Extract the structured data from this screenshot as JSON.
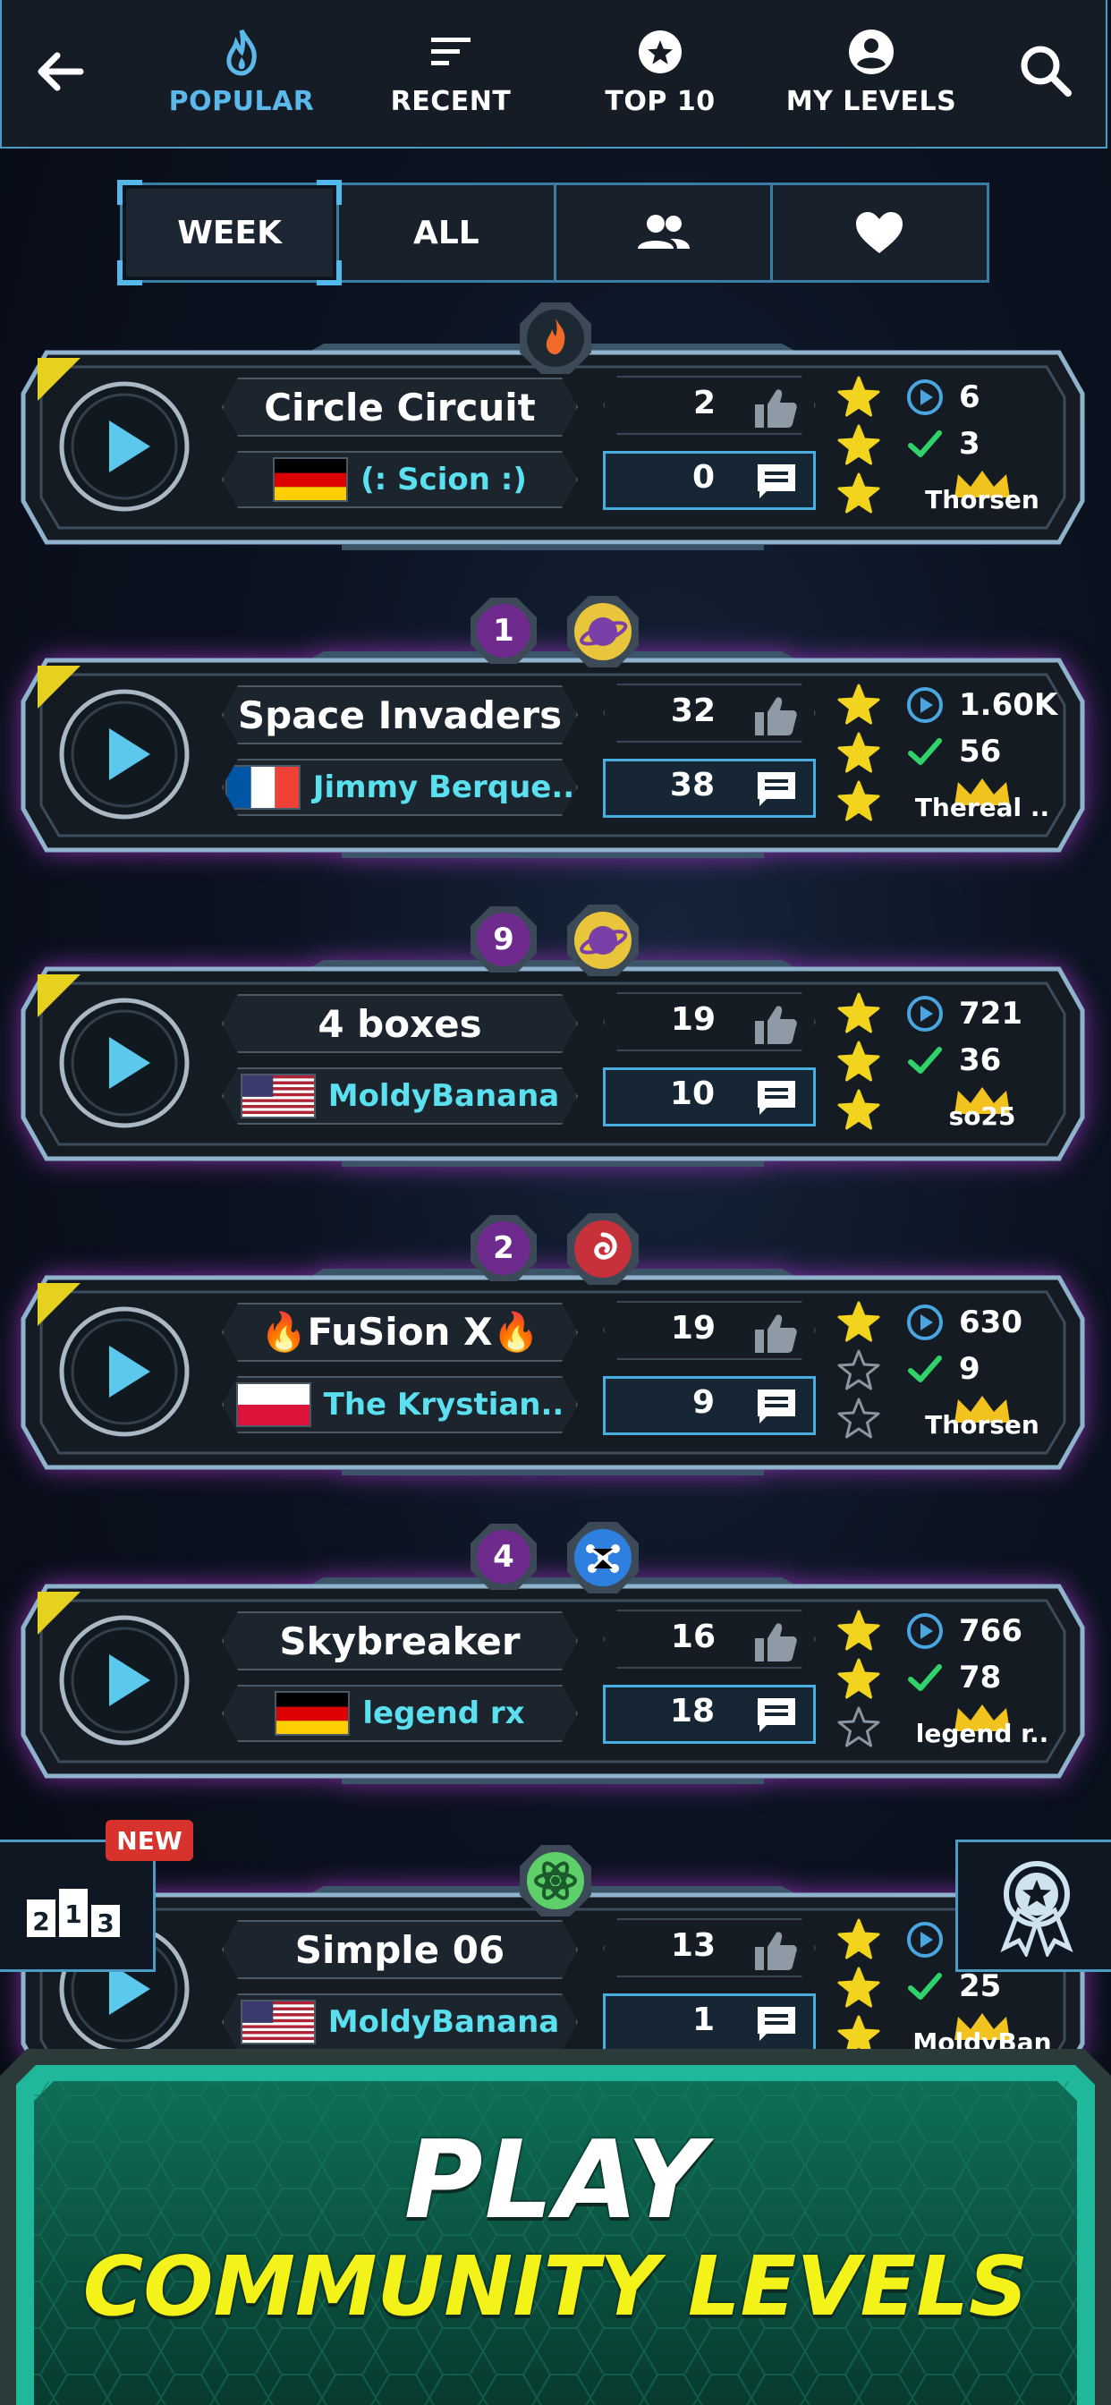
{
  "nav": {
    "tabs": [
      {
        "label": "POPULAR",
        "icon": "flame-icon",
        "active": true
      },
      {
        "label": "RECENT",
        "icon": "sort-lines-icon",
        "active": false
      },
      {
        "label": "TOP 10",
        "icon": "star-circle-icon",
        "active": false
      },
      {
        "label": "MY LEVELS",
        "icon": "account-circle-icon",
        "active": false
      }
    ]
  },
  "filters": {
    "week": "WEEK",
    "all": "ALL",
    "friends_icon": "people-icon",
    "favorites_icon": "heart-icon"
  },
  "levels": [
    {
      "name": "Circle Circuit",
      "author": "(: Scion :)",
      "flag": "germany",
      "likes": "2",
      "comments": "0",
      "stars": 3,
      "plays": "6",
      "completions": "3",
      "owner": "Thorsen",
      "owner_crown": false,
      "rank": "",
      "category_icon": "flame-icon"
    },
    {
      "name": "Space Invaders",
      "author": "Jimmy Berque..",
      "flag": "france",
      "likes": "32",
      "comments": "38",
      "stars": 3,
      "plays": "1.60K",
      "completions": "56",
      "owner": "Thereal ..",
      "owner_crown": true,
      "rank": "1",
      "category_icon": "planet-icon"
    },
    {
      "name": "4 boxes",
      "author": "MoldyBanana",
      "flag": "usa",
      "likes": "19",
      "comments": "10",
      "stars": 3,
      "plays": "721",
      "completions": "36",
      "owner": "so25",
      "owner_crown": true,
      "rank": "9",
      "category_icon": "planet-icon"
    },
    {
      "name": "🔥FuSion X🔥",
      "author": "The Krystian..",
      "flag": "poland",
      "likes": "19",
      "comments": "9",
      "stars": 1,
      "plays": "630",
      "completions": "9",
      "owner": "Thorsen",
      "owner_crown": true,
      "rank": "2",
      "category_icon": "spiral-icon"
    },
    {
      "name": "Skybreaker",
      "author": "legend rx",
      "flag": "germany",
      "likes": "16",
      "comments": "18",
      "stars": 2,
      "plays": "766",
      "completions": "78",
      "owner": "legend r..",
      "owner_crown": true,
      "rank": "4",
      "category_icon": "molecule-icon"
    },
    {
      "name": "Simple 06",
      "author": "MoldyBanana",
      "flag": "usa",
      "likes": "13",
      "comments": "1",
      "stars": 3,
      "plays": "",
      "completions": "25",
      "owner": "MoldyBan",
      "owner_crown": true,
      "rank": "",
      "category_icon": "atom-icon"
    }
  ],
  "side": {
    "new_badge": "NEW",
    "podium_digits": [
      "2",
      "1",
      "3"
    ]
  },
  "banner": {
    "line1": "PLAY",
    "line2": "COMMUNITY LEVELS"
  },
  "colors": {
    "accent_blue": "#5ab9ea",
    "star_yellow": "#f2d41e",
    "check_green": "#2fd36a",
    "purple_glow": "#be3ce6",
    "banner_green": "#0e5a48",
    "banner_yellow": "#f3f31a"
  }
}
